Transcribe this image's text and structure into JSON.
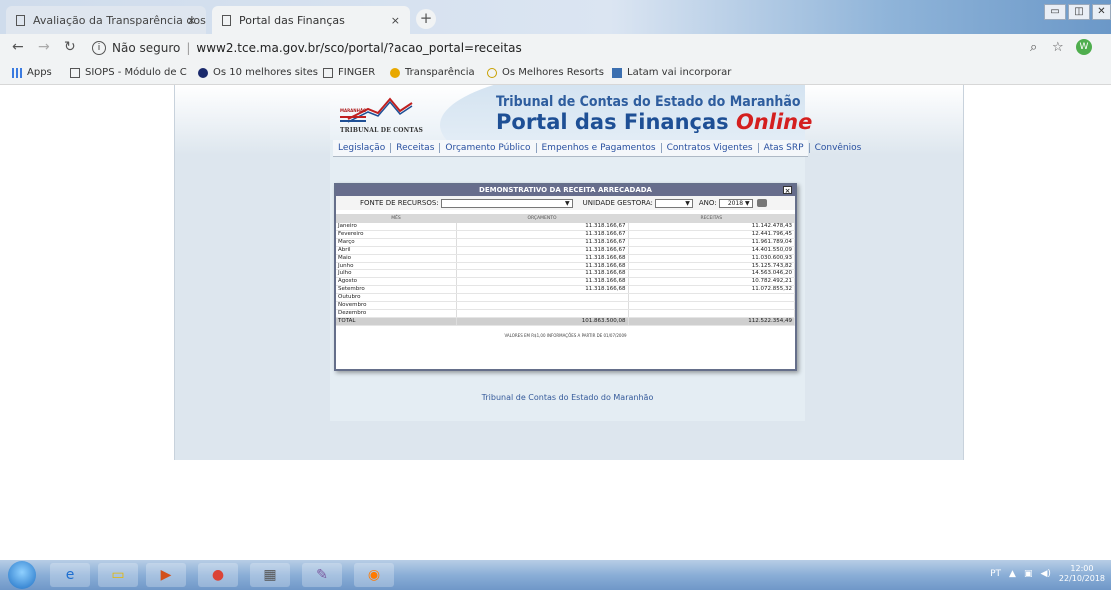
{
  "browser": {
    "tabs": [
      {
        "title": "Avaliação da Transparência dos ",
        "active": false
      },
      {
        "title": "Portal das Finanças",
        "active": true
      }
    ],
    "new_tab": "+",
    "close": "×",
    "security_label": "Não seguro",
    "url": "www2.tce.ma.gov.br/sco/portal/?acao_portal=receitas",
    "profile_initial": "W"
  },
  "bookmarks": [
    {
      "label": "Apps",
      "icon": "apps-grid-icon"
    },
    {
      "label": "SIOPS - Módulo de C",
      "icon": "page-icon"
    },
    {
      "label": "Os 10 melhores sites",
      "icon": "moon-icon"
    },
    {
      "label": "FINGER",
      "icon": "page-icon"
    },
    {
      "label": "Transparência",
      "icon": "info-icon"
    },
    {
      "label": "Os Melhores Resorts",
      "icon": "s-icon"
    },
    {
      "label": "Latam vai incorporar",
      "icon": "news-icon"
    }
  ],
  "site": {
    "logo_small": "MARANHÃO",
    "logo_caption": "TRIBUNAL DE CONTAS",
    "title_line1": "Tribunal de Contas do Estado do Maranhão",
    "title_line2": "Portal das Finanças",
    "title_online": "Online",
    "menu": [
      "Legislação",
      "Receitas",
      "Orçamento Público",
      "Empenhos e Pagamentos",
      "Contratos Vigentes",
      "Atas SRP",
      "Convênios"
    ],
    "footer": "Tribunal de Contas do Estado do Maranhão"
  },
  "modal": {
    "title": "DEMONSTRATIVO DA RECEITA ARRECADADA",
    "close": "×",
    "fonte_label": "FONTE DE RECURSOS:",
    "fonte_value": "▼",
    "unidade_label": "UNIDADE GESTORA:",
    "unidade_value": "▼",
    "ano_label": "ANO:",
    "ano_value": "2018 ▼",
    "columns": [
      "MÊS",
      "ORÇAMENTO",
      "RECEITAS"
    ],
    "rows": [
      [
        "Janeiro",
        "11.318.166,67",
        "11.142.478,43"
      ],
      [
        "Fevereiro",
        "11.318.166,67",
        "12.441.796,45"
      ],
      [
        "Março",
        "11.318.166,67",
        "11.961.789,04"
      ],
      [
        "Abril",
        "11.318.166,67",
        "14.401.550,09"
      ],
      [
        "Maio",
        "11.318.166,68",
        "11.030.600,93"
      ],
      [
        "Junho",
        "11.318.166,68",
        "15.125.743,82"
      ],
      [
        "Julho",
        "11.318.166,68",
        "14.563.046,20"
      ],
      [
        "Agosto",
        "11.318.166,68",
        "10.782.492,21"
      ],
      [
        "Setembro",
        "11.318.166,68",
        "11.072.855,32"
      ],
      [
        "Outubro",
        "",
        ""
      ],
      [
        "Novembro",
        "",
        ""
      ],
      [
        "Dezembro",
        "",
        ""
      ]
    ],
    "total": [
      "TOTAL",
      "101.863.500,08",
      "112.522.354,49"
    ],
    "footnote": "VALORES EM R$1,00   INFORMAÇÕES A PARTIR DE 01/07/2009"
  },
  "taskbar": {
    "language": "PT",
    "time": "12:00",
    "date": "22/10/2018"
  }
}
